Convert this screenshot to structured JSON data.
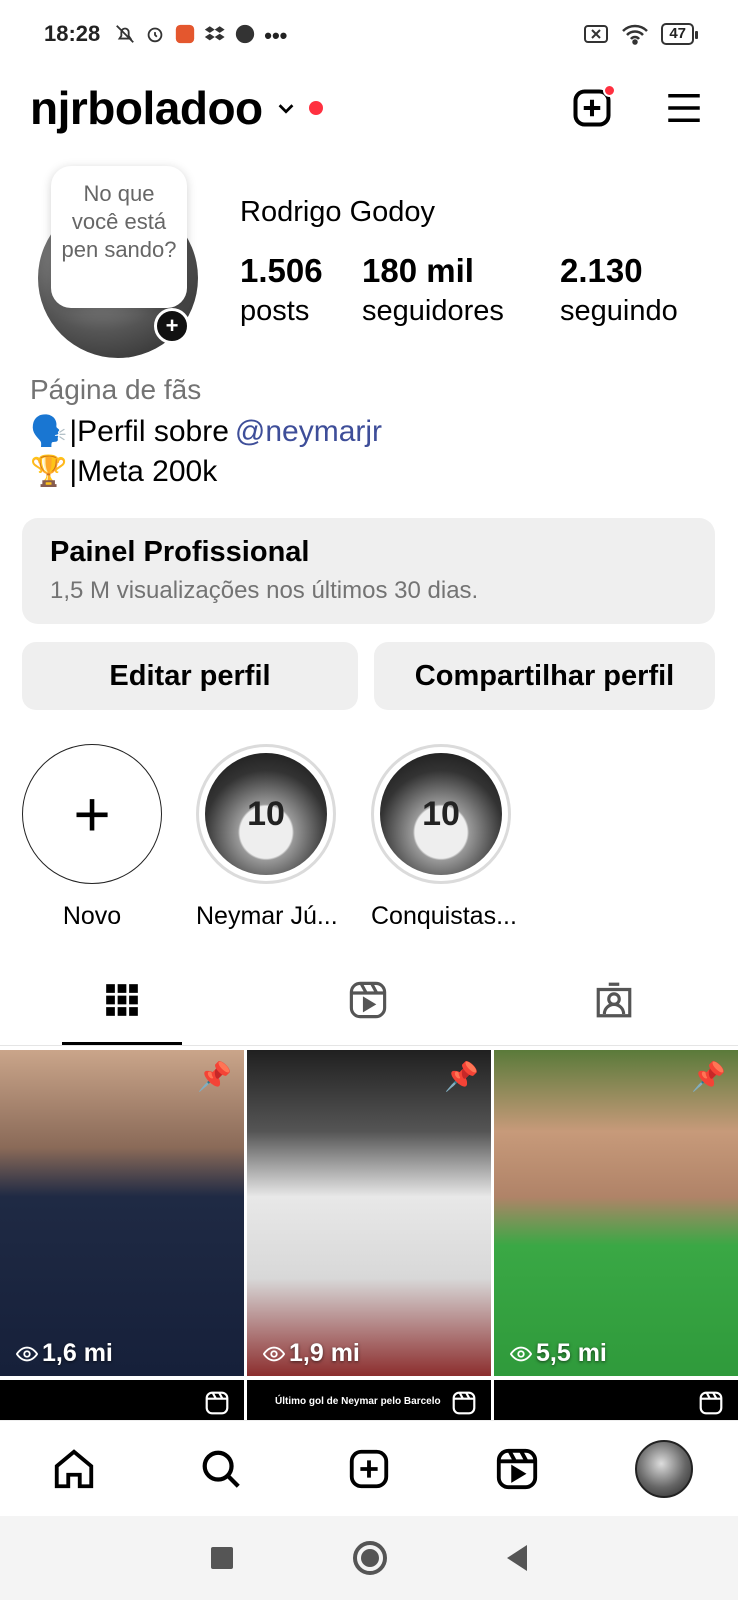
{
  "status_bar": {
    "time": "18:28",
    "battery": "47"
  },
  "header": {
    "username": "njrboladoo"
  },
  "profile": {
    "note_bubble": "No que você está pen sando?",
    "full_name": "Rodrigo Godoy",
    "stats": [
      {
        "value": "1.506",
        "label": "posts"
      },
      {
        "value": "180 mil",
        "label": "seguidores"
      },
      {
        "value": "2.130",
        "label": "seguindo"
      }
    ],
    "category": "Página de fãs",
    "bio_line1_prefix": "|Perfil sobre",
    "bio_line1_mention": "@neymarjr",
    "bio_line2": "|Meta 200k",
    "bio_emoji1": "🗣️",
    "bio_emoji2": "🏆"
  },
  "panel": {
    "title": "Painel Profissional",
    "subtitle": "1,5 M visualizações nos últimos 30 dias."
  },
  "buttons": {
    "edit": "Editar perfil",
    "share": "Compartilhar perfil"
  },
  "highlights": [
    {
      "label": "Novo"
    },
    {
      "label": "Neymar Jú..."
    },
    {
      "label": "Conquistas..."
    }
  ],
  "grid": {
    "posts": [
      {
        "views": "1,6 mi",
        "pinned": true,
        "bg": "#1f2a44"
      },
      {
        "views": "1,9 mi",
        "pinned": true,
        "bg": "#7c2f2f"
      },
      {
        "views": "5,5 mi",
        "pinned": true,
        "bg": "#3aa845"
      }
    ],
    "second_row_caption": "Último gol de Neymar pelo Barcelo"
  },
  "colors": {
    "accent_red": "#ff3040",
    "mention_blue": "#3e4e99",
    "button_bg": "#efefef"
  }
}
